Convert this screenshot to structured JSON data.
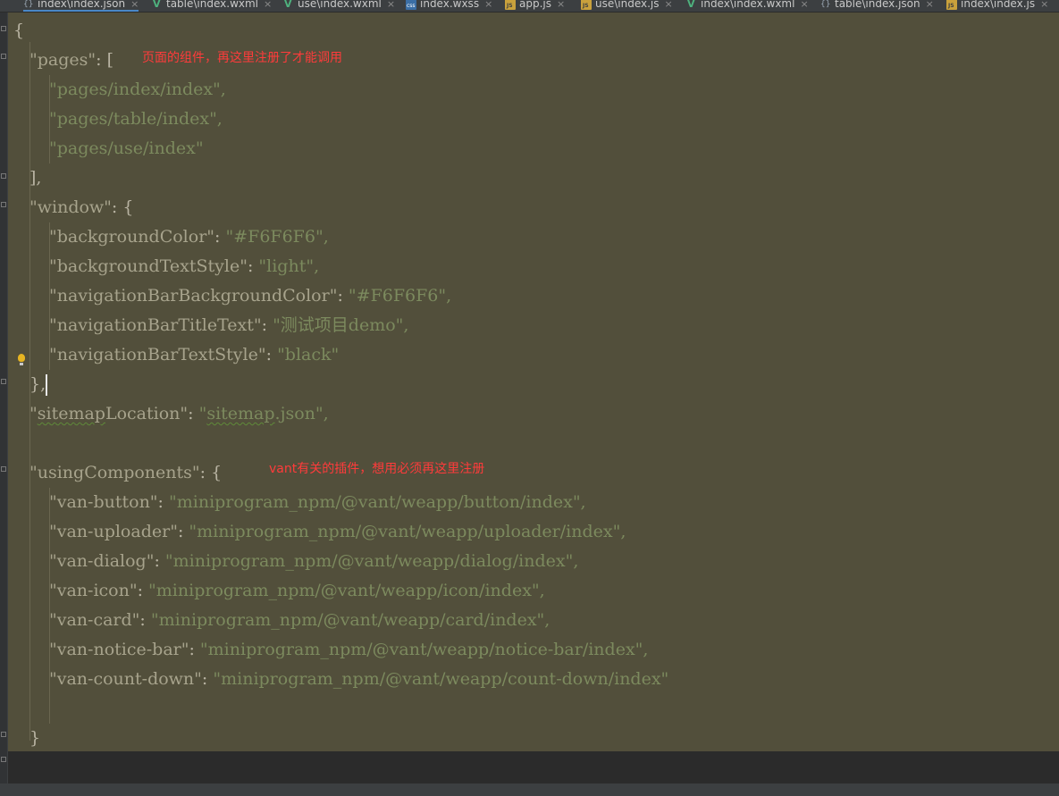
{
  "tabs": [
    {
      "label": "index\\index.json",
      "icon": "json-file-icon"
    },
    {
      "label": "table\\index.wxml",
      "icon": "wxml-file-icon"
    },
    {
      "label": "use\\index.wxml",
      "icon": "wxml-file-icon"
    },
    {
      "label": "index.wxss",
      "icon": "wxss-file-icon"
    },
    {
      "label": "app.js",
      "icon": "js-file-icon"
    },
    {
      "label": "use\\index.js",
      "icon": "js-file-icon"
    },
    {
      "label": "index\\index.wxml",
      "icon": "wxml-file-icon"
    },
    {
      "label": "table\\index.json",
      "icon": "json-file-icon"
    },
    {
      "label": "index\\index.js",
      "icon": "js-file-icon"
    }
  ],
  "tab_close": "×",
  "code": {
    "open_brace": "{",
    "pages_key": "\"pages\"",
    "pages_open": ": [",
    "pages": [
      "\"pages/index/index\",",
      "\"pages/table/index\",",
      "\"pages/use/index\""
    ],
    "pages_close": "],",
    "window_key": "\"window\"",
    "window_open": ": {",
    "window_props": [
      {
        "key": "\"backgroundColor\"",
        "value": "\"#F6F6F6\","
      },
      {
        "key": "\"backgroundTextStyle\"",
        "value": "\"light\","
      },
      {
        "key": "\"navigationBarBackgroundColor\"",
        "value": "\"#F6F6F6\","
      },
      {
        "key": "\"navigationBarTitleText\"",
        "value": "\"测试项目demo\","
      },
      {
        "key": "\"navigationBarTextStyle\"",
        "value": "\"black\""
      }
    ],
    "window_close": "},",
    "sitemap_key_q": "\"",
    "sitemap_key_word": "sitemap",
    "sitemap_key_rest": "Location\"",
    "sitemap_sep": ": ",
    "sitemap_value_q": "\"",
    "sitemap_value_word": "sitemap",
    "sitemap_value_rest": ".json\",",
    "components_key": "\"usingComponents\"",
    "components_open": ": {",
    "components": [
      {
        "key": "\"van-button\"",
        "value": "\"miniprogram_npm/@vant/weapp/button/index\","
      },
      {
        "key": "\"van-uploader\"",
        "value": "\"miniprogram_npm/@vant/weapp/uploader/index\","
      },
      {
        "key": "\"van-dialog\"",
        "value": "\"miniprogram_npm/@vant/weapp/dialog/index\","
      },
      {
        "key": "\"van-icon\"",
        "value": "\"miniprogram_npm/@vant/weapp/icon/index\","
      },
      {
        "key": "\"van-card\"",
        "value": "\"miniprogram_npm/@vant/weapp/card/index\","
      },
      {
        "key": "\"van-notice-bar\"",
        "value": "\"miniprogram_npm/@vant/weapp/notice-bar/index\","
      },
      {
        "key": "\"van-count-down\"",
        "value": "\"miniprogram_npm/@vant/weapp/count-down/index\""
      }
    ],
    "components_close": "}",
    "close_brace": "}"
  },
  "annotations": {
    "pages_note": "页面的组件，再这里注册了才能调用",
    "components_note": "vant有关的插件，想用必须再这里注册"
  },
  "colors": {
    "editor_bg": "#524f3b",
    "annotation": "#ff3b3b",
    "active_tab_underline": "#4a88c7"
  }
}
